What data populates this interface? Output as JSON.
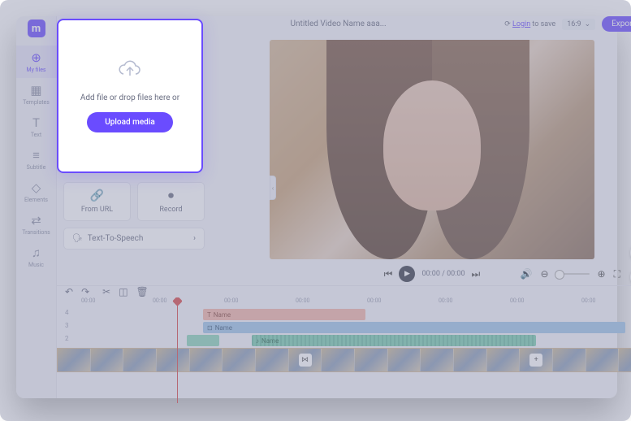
{
  "logo": "m",
  "sidebar": {
    "items": [
      {
        "label": "My files",
        "icon": "⊕"
      },
      {
        "label": "Templates",
        "icon": "▦"
      },
      {
        "label": "Text",
        "icon": "T"
      },
      {
        "label": "Subtitle",
        "icon": "≡"
      },
      {
        "label": "Elements",
        "icon": "◇"
      },
      {
        "label": "Transitions",
        "icon": "⇄"
      },
      {
        "label": "Music",
        "icon": "♫"
      }
    ]
  },
  "topbar": {
    "title": "Untitled Video Name aaa...",
    "login_text": "Login",
    "save_text": " to save",
    "ratio": "16:9",
    "export": "Export"
  },
  "panel": {
    "from_url": "From URL",
    "record": "Record",
    "tts": "Text-To-Speech"
  },
  "upload": {
    "hint": "Add file or drop files here or",
    "button": "Upload media"
  },
  "playback": {
    "current": "00:00",
    "total": "00:00"
  },
  "ruler": [
    "00:00",
    "00:00",
    "00:00",
    "00:00",
    "00:00",
    "00:00",
    "00:00",
    "00:00"
  ],
  "tracks": {
    "text_clip": "Name",
    "sub_clip": "Name",
    "audio_clip": "Name"
  }
}
